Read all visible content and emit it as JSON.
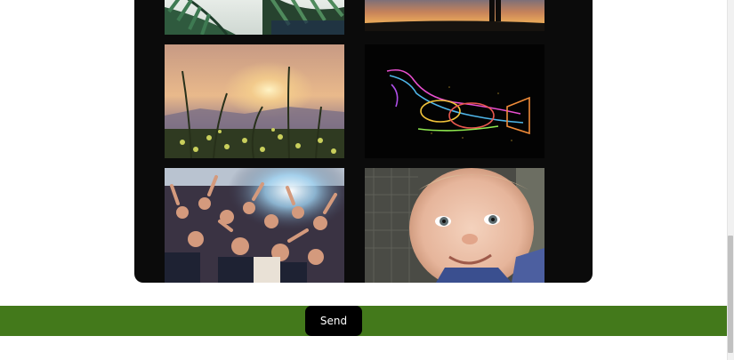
{
  "gallery": {
    "photos": [
      {
        "subject": "palm-leaves-photo"
      },
      {
        "subject": "sunset-silhouette-photo"
      },
      {
        "subject": "wildflowers-sunset-photo"
      },
      {
        "subject": "neon-trumpet-photo"
      },
      {
        "subject": "concert-crowd-photo"
      },
      {
        "subject": "smiling-baby-photo"
      }
    ]
  },
  "footer": {
    "send_label": "Send",
    "bar_color": "#43791b"
  }
}
